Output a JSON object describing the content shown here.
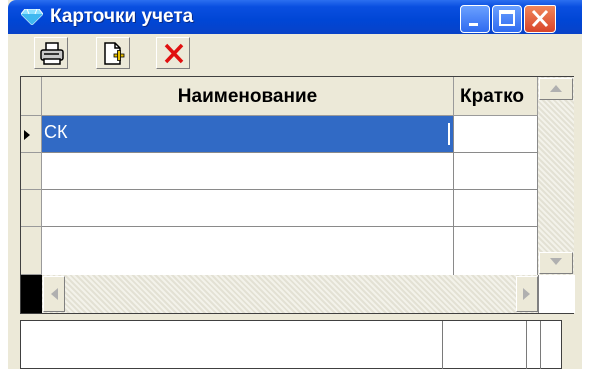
{
  "window": {
    "title": "Карточки учета",
    "icon": "diamond-icon",
    "controls": [
      "minimize-icon",
      "maximize-icon",
      "close-icon"
    ]
  },
  "toolbar": {
    "buttons": [
      {
        "name": "print-button",
        "icon": "printer-icon"
      },
      {
        "name": "new-record-button",
        "icon": "new-document-icon"
      },
      {
        "name": "delete-button",
        "icon": "red-x-icon"
      }
    ]
  },
  "grid": {
    "columns": [
      "Наименование",
      "Кратко"
    ],
    "rows": [
      [
        "СК",
        ""
      ],
      [
        "",
        ""
      ],
      [
        "",
        ""
      ],
      [
        "",
        ""
      ]
    ],
    "selected_row": 0,
    "selection_color": "#316ac5"
  },
  "colors": {
    "titlebar": "#0046d5",
    "close_button": "#d8442a",
    "window_face": "#ece9d8"
  }
}
